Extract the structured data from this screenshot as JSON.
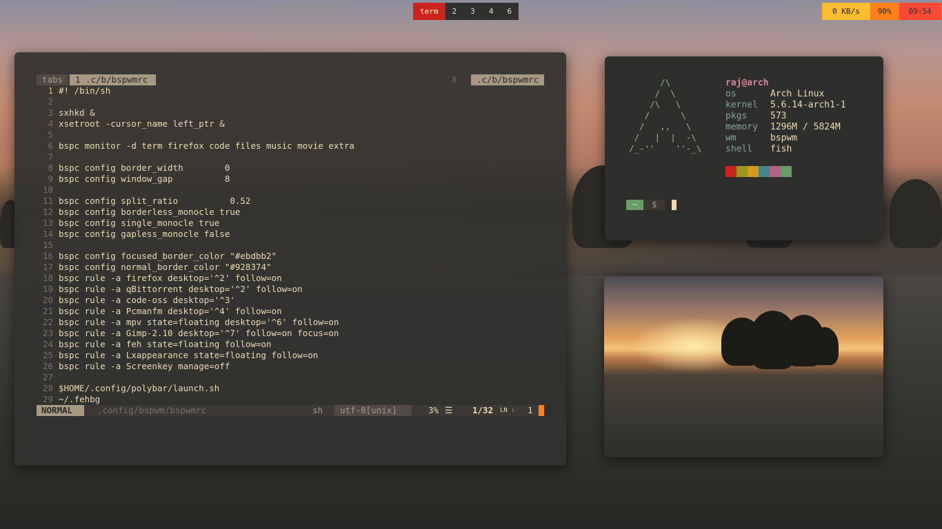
{
  "bar": {
    "workspaces": [
      "term",
      "2",
      "3",
      "4",
      "6"
    ],
    "active_workspace": "term",
    "net": "0 KB/s",
    "volume": "90%",
    "clock": "09:54"
  },
  "editor": {
    "tabline": {
      "label": "tabs",
      "tab": "1 .c/b/bspwmrc",
      "close": "X",
      "right_name": ".c/b/bspwmrc"
    },
    "lines": [
      "#! /bin/sh",
      "",
      "sxhkd &",
      "xsetroot -cursor_name left_ptr &",
      "",
      "bspc monitor -d term firefox code files music movie extra",
      "",
      "bspc config border_width        0",
      "bspc config window_gap          8",
      "",
      "bspc config split_ratio          0.52",
      "bspc config borderless_monocle true",
      "bspc config single_monocle true",
      "bspc config gapless_monocle false",
      "",
      "bspc config focused_border_color \"#ebdbb2\"",
      "bspc config normal_border_color \"#928374\"",
      "bspc rule -a firefox desktop='^2' follow=on",
      "bspc rule -a qBittorrent desktop='^2' follow=on",
      "bspc rule -a code-oss desktop='^3'",
      "bspc rule -a Pcmanfm desktop='^4' follow=on",
      "bspc rule -a mpv state=floating desktop='^6' follow=on",
      "bspc rule -a Gimp-2.10 desktop='^7' follow=on focus=on",
      "bspc rule -a feh state=floating follow=on",
      "bspc rule -a Lxappearance state=floating follow=on",
      "bspc rule -a Screenkey manage=off",
      "",
      "$HOME/.config/polybar/launch.sh",
      "~/.fehbg"
    ],
    "statusline": {
      "mode": "NORMAL",
      "file": ".config/bspwm/bspwmrc",
      "filetype": "sh",
      "encoding": "utf-8[unix]",
      "percent": "3%",
      "position": "1/32",
      "column": "1"
    }
  },
  "fetch": {
    "user": "raj@arch",
    "rows": [
      {
        "key": "os",
        "val": "Arch Linux"
      },
      {
        "key": "kernel",
        "val": "5.6.14-arch1-1"
      },
      {
        "key": "pkgs",
        "val": "573"
      },
      {
        "key": "memory",
        "val": "1296M / 5824M"
      },
      {
        "key": "wm",
        "val": "bspwm"
      },
      {
        "key": "shell",
        "val": "fish"
      }
    ],
    "logo": "      /\\\n     /  \\\n    /\\   \\\n   /      \\\n  /   ,,   \\\n /   |  |  -\\\n/_-''    ''-_\\",
    "swatch_colors": [
      "#cc241d",
      "#98971a",
      "#d79921",
      "#458588",
      "#b16286",
      "#689d6a"
    ],
    "prompt": {
      "dir": "~",
      "symbol": "$"
    }
  },
  "colors": {
    "bg": "#32302f",
    "fg": "#ebdbb2",
    "red": "#cc241d",
    "yellow": "#fabd2f",
    "orange": "#fe8019"
  }
}
